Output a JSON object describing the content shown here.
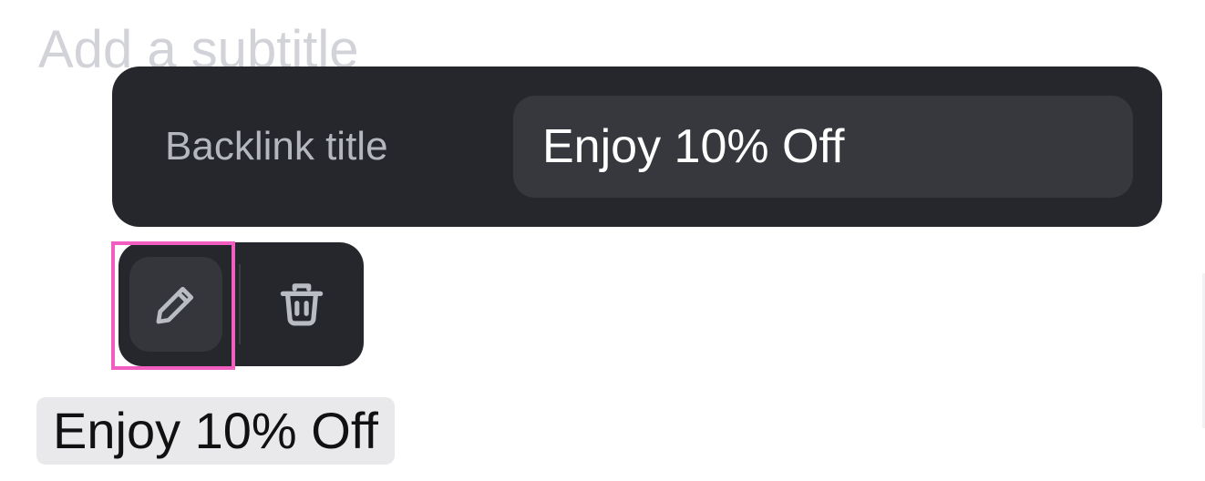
{
  "editor": {
    "subtitle_placeholder": "Add a subtitle",
    "link_text": "Enjoy 10% Off"
  },
  "backlink_popover": {
    "label": "Backlink title",
    "title_value": "Enjoy 10% Off"
  },
  "link_toolbar": {
    "edit_icon": "pencil-icon",
    "delete_icon": "trash-icon"
  },
  "colors": {
    "popover_background": "#25272c",
    "input_background": "#36383e",
    "highlight": "#f25ebf",
    "placeholder": "#d1d3d8",
    "chip_background": "#e9e9eb"
  }
}
